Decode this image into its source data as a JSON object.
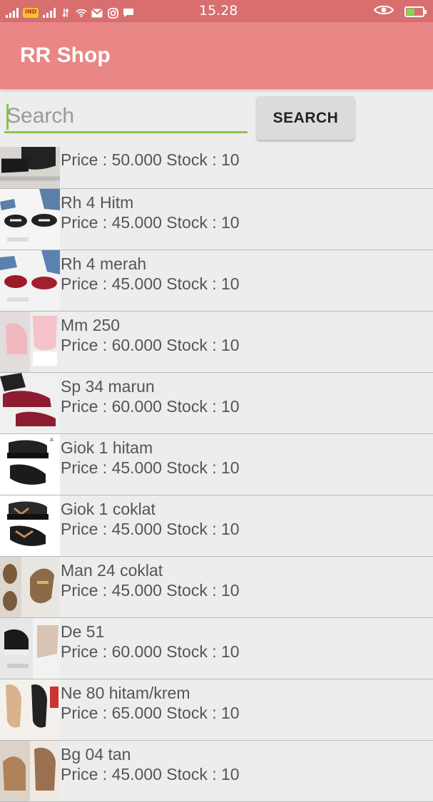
{
  "status_bar": {
    "time": "15.28",
    "carrier_logo_text": "Indosat"
  },
  "app": {
    "title": "RR Shop",
    "accent_color": "#e98686",
    "status_color": "#d86e6e"
  },
  "search": {
    "placeholder": "Search",
    "value": "",
    "button_label": "SEARCH",
    "underline_color": "#8bc34a"
  },
  "products": [
    {
      "name": "",
      "info": "Price : 50.000 Stock : 10",
      "thumb": "black-wedge"
    },
    {
      "name": "Rh 4 Hitm",
      "info": "Price : 45.000 Stock : 10",
      "thumb": "black-loafer"
    },
    {
      "name": "Rh 4 merah",
      "info": "Price : 45.000 Stock : 10",
      "thumb": "red-loafer"
    },
    {
      "name": "Mm 250",
      "info": "Price : 60.000 Stock : 10",
      "thumb": "pink-sneaker"
    },
    {
      "name": "Sp 34 marun",
      "info": "Price : 60.000 Stock : 10",
      "thumb": "maroon-sneaker"
    },
    {
      "name": "Giok 1 hitam",
      "info": "Price : 45.000 Stock : 10",
      "thumb": "black-platform-sandal"
    },
    {
      "name": "Giok 1 coklat",
      "info": "Price : 45.000 Stock : 10",
      "thumb": "brown-platform-sandal"
    },
    {
      "name": "Man 24 coklat",
      "info": "Price : 45.000 Stock : 10",
      "thumb": "brown-loafer"
    },
    {
      "name": "De 51",
      "info": "Price : 60.000 Stock : 10",
      "thumb": "black-wedge-sneaker"
    },
    {
      "name": "Ne 80 hitam/krem",
      "info": "Price : 65.000 Stock : 10",
      "thumb": "cream-flat"
    },
    {
      "name": "Bg 04 tan",
      "info": "Price : 45.000 Stock : 10",
      "thumb": "tan-shoe"
    }
  ]
}
